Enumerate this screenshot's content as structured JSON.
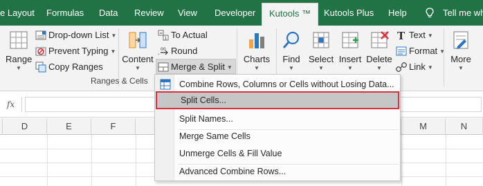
{
  "tabs": {
    "page_layout": "e Layout",
    "formulas": "Formulas",
    "data": "Data",
    "review": "Review",
    "view": "View",
    "developer": "Developer",
    "kutools": "Kutools ™",
    "kutools_plus": "Kutools Plus",
    "help": "Help",
    "tell_me": "Tell me whe"
  },
  "ribbon": {
    "range_label": "Range",
    "dropdown_list": "Drop-down List",
    "prevent_typing": "Prevent Typing",
    "copy_ranges": "Copy Ranges",
    "content_label": "Content",
    "to_actual": "To Actual",
    "round": "Round",
    "merge_split": "Merge & Split",
    "group_ranges_cells": "Ranges & Cells",
    "charts": "Charts",
    "find": "Find",
    "select": "Select",
    "insert": "Insert",
    "delete": "Delete",
    "text": "Text",
    "format": "Format",
    "link": "Link",
    "more": "More"
  },
  "formula_bar": {
    "fx": "fx",
    "value": ""
  },
  "columns": [
    "D",
    "E",
    "F",
    "M",
    "N"
  ],
  "menu": {
    "items": [
      "Combine Rows, Columns or Cells without Losing Data...",
      "Split Cells...",
      "Split Names...",
      "Merge Same Cells",
      "Unmerge Cells & Fill Value",
      "Advanced Combine Rows..."
    ]
  },
  "colors": {
    "excel_green": "#217346",
    "highlight_border": "#d9313c"
  }
}
